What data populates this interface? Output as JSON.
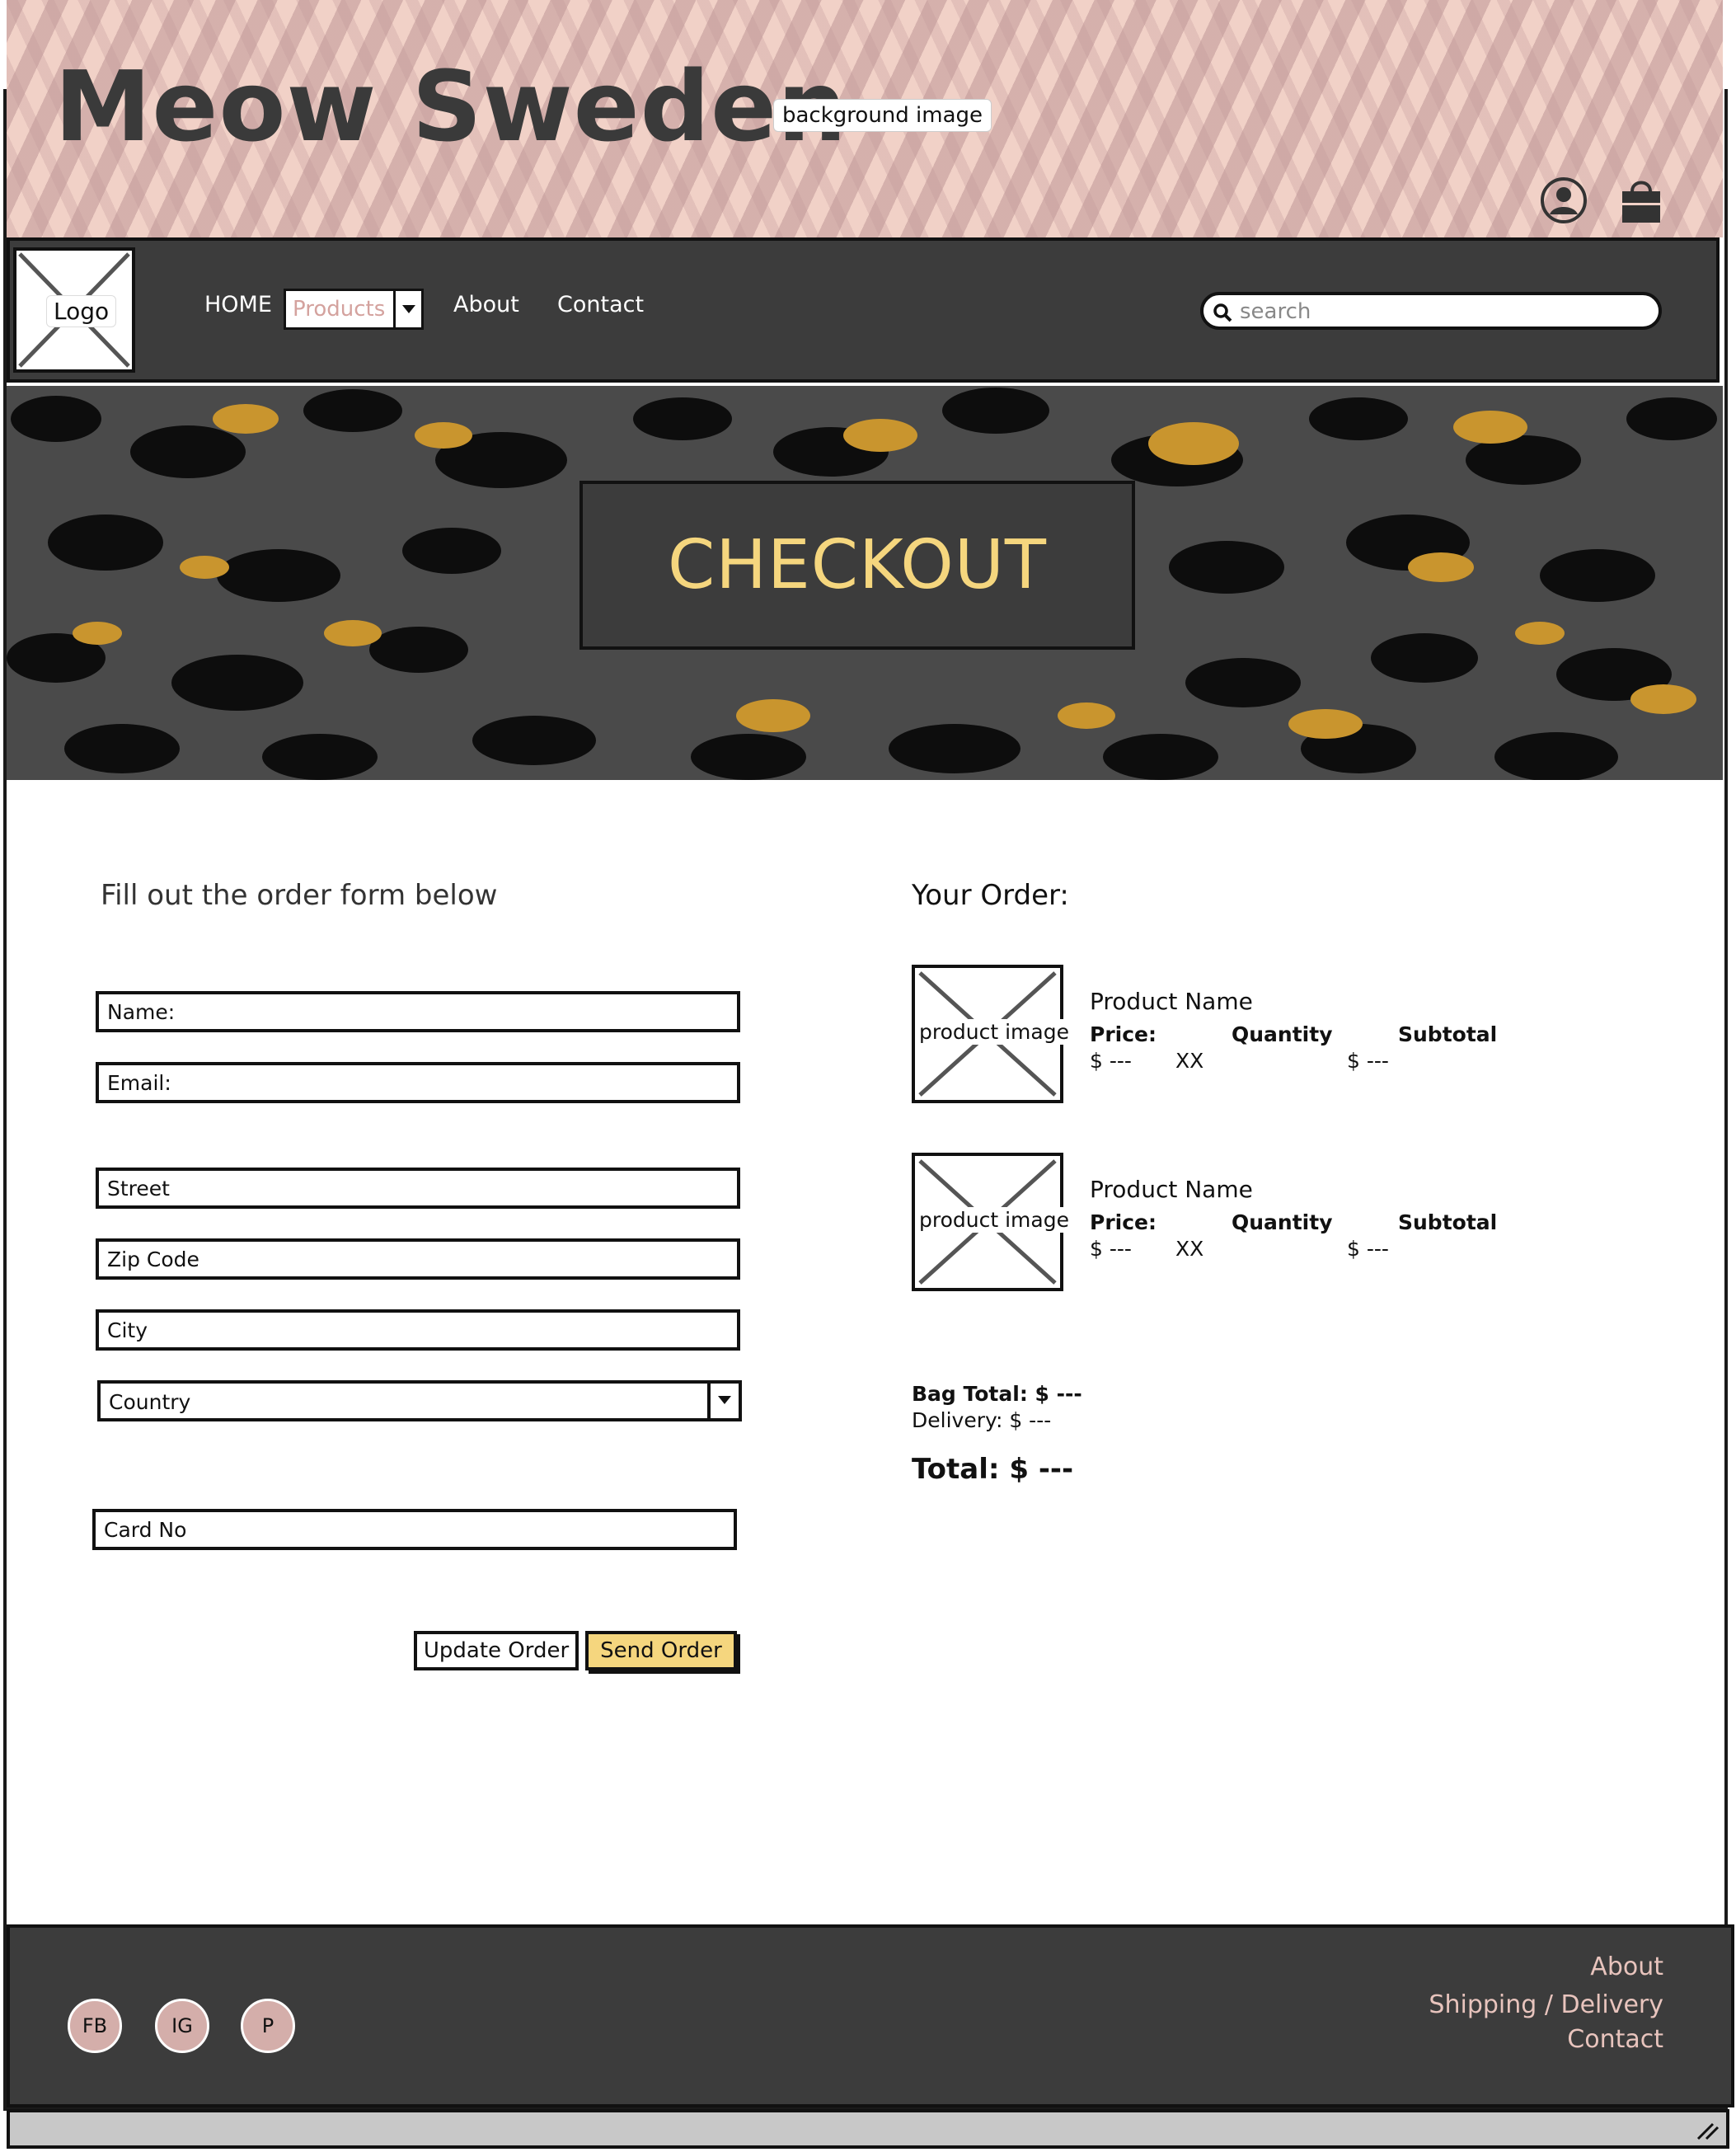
{
  "header": {
    "site_title": "Meow Sweden",
    "background_label": "background image",
    "icons": [
      "user-icon",
      "shopping-bag-icon"
    ]
  },
  "nav": {
    "logo_label": "Logo",
    "home": "HOME",
    "products": "Products",
    "about": "About",
    "contact": "Contact",
    "search_placeholder": "search"
  },
  "hero": {
    "title": "CHECKOUT"
  },
  "form": {
    "heading": "Fill out the order form below",
    "name_placeholder": "Name:",
    "email_placeholder": "Email:",
    "street_placeholder": "Street",
    "zip_placeholder": "Zip Code",
    "city_placeholder": "City",
    "country_value": "Country",
    "card_placeholder": "Card No",
    "update_button": "Update Order",
    "send_button": "Send Order"
  },
  "order": {
    "heading": "Your Order:",
    "items": [
      {
        "image_label": "product image",
        "name": "Product Name",
        "price_label": "Price:",
        "quantity_label": "Quantity",
        "subtotal_label": "Subtotal",
        "price": "$ ---",
        "quantity": "XX",
        "subtotal": "$ ---"
      },
      {
        "image_label": "product image",
        "name": "Product Name",
        "price_label": "Price:",
        "quantity_label": "Quantity",
        "subtotal_label": "Subtotal",
        "price": "$ ---",
        "quantity": "XX",
        "subtotal": "$ ---"
      }
    ],
    "bag_total": "Bag Total: $ ---",
    "delivery": "Delivery: $ ---",
    "total": "Total: $ ---"
  },
  "footer": {
    "social": [
      "FB",
      "IG",
      "P"
    ],
    "links": [
      "About",
      "Shipping / Delivery",
      "Contact"
    ]
  },
  "colors": {
    "header_pink": "#f1d1c7",
    "nav_dark": "#3c3c3c",
    "accent_gold": "#f5d67e",
    "footer_link_pink": "#e8c4bd",
    "products_pink": "#d4a29e"
  }
}
